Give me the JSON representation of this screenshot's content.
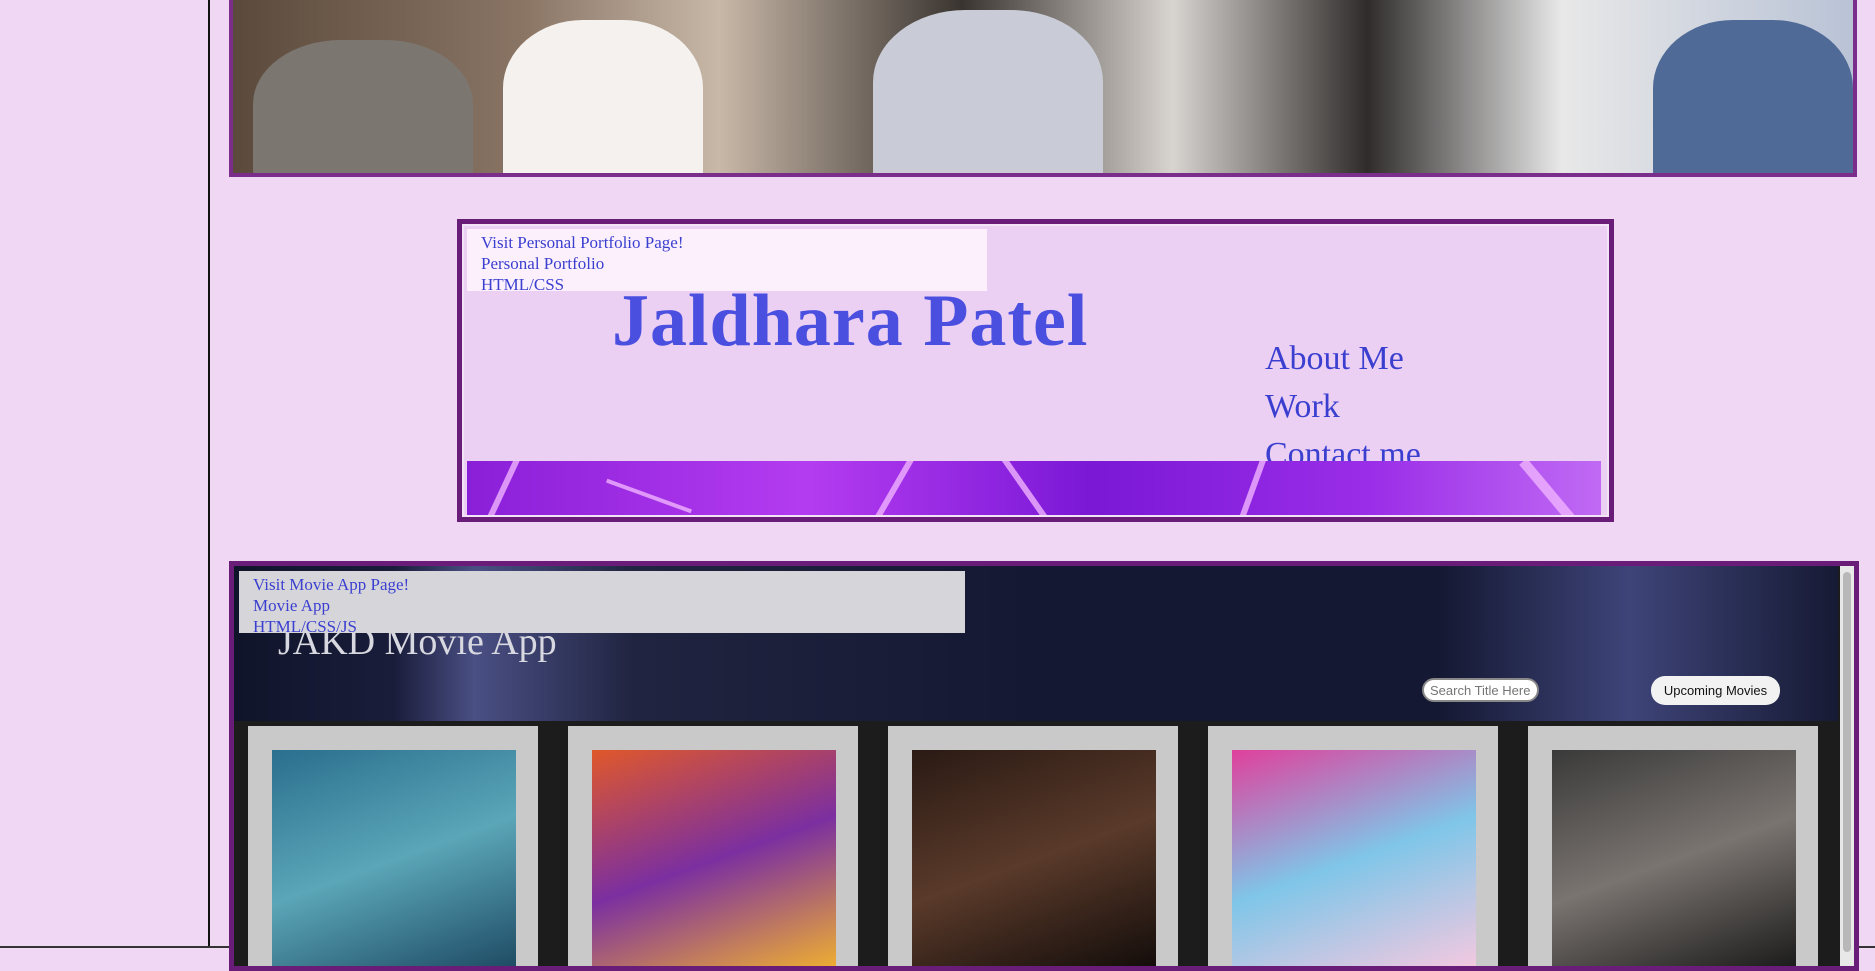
{
  "portfolio": {
    "visit": "Visit Personal Portfolio Page!",
    "name": "Personal Portfolio",
    "tech": "HTML/CSS",
    "title": "Jaldhara Patel",
    "nav": [
      "About Me",
      "Work",
      "Contact me"
    ]
  },
  "movie_app": {
    "visit": "Visit Movie App Page!",
    "name": "Movie App",
    "tech": "HTML/CSS/JS",
    "title": "JAKD Movie App",
    "search_placeholder": "Search Title Here",
    "upcoming_label": "Upcoming Movies",
    "posters": [
      {
        "name": "underwater-poster",
        "colors": [
          "#2a6f8e",
          "#5ba6b8",
          "#1d4a63"
        ]
      },
      {
        "name": "spider-poster",
        "colors": [
          "#e0582a",
          "#7b2fa0",
          "#f0b030"
        ]
      },
      {
        "name": "dark-portrait-poster",
        "colors": [
          "#2a1a14",
          "#5a3a2a",
          "#120c0a"
        ]
      },
      {
        "name": "pink-poster",
        "colors": [
          "#e0409c",
          "#7fc6e8",
          "#f6c8e0"
        ]
      },
      {
        "name": "group-poster",
        "colors": [
          "#3a3a3a",
          "#7a7470",
          "#1a1a1a"
        ]
      }
    ]
  }
}
